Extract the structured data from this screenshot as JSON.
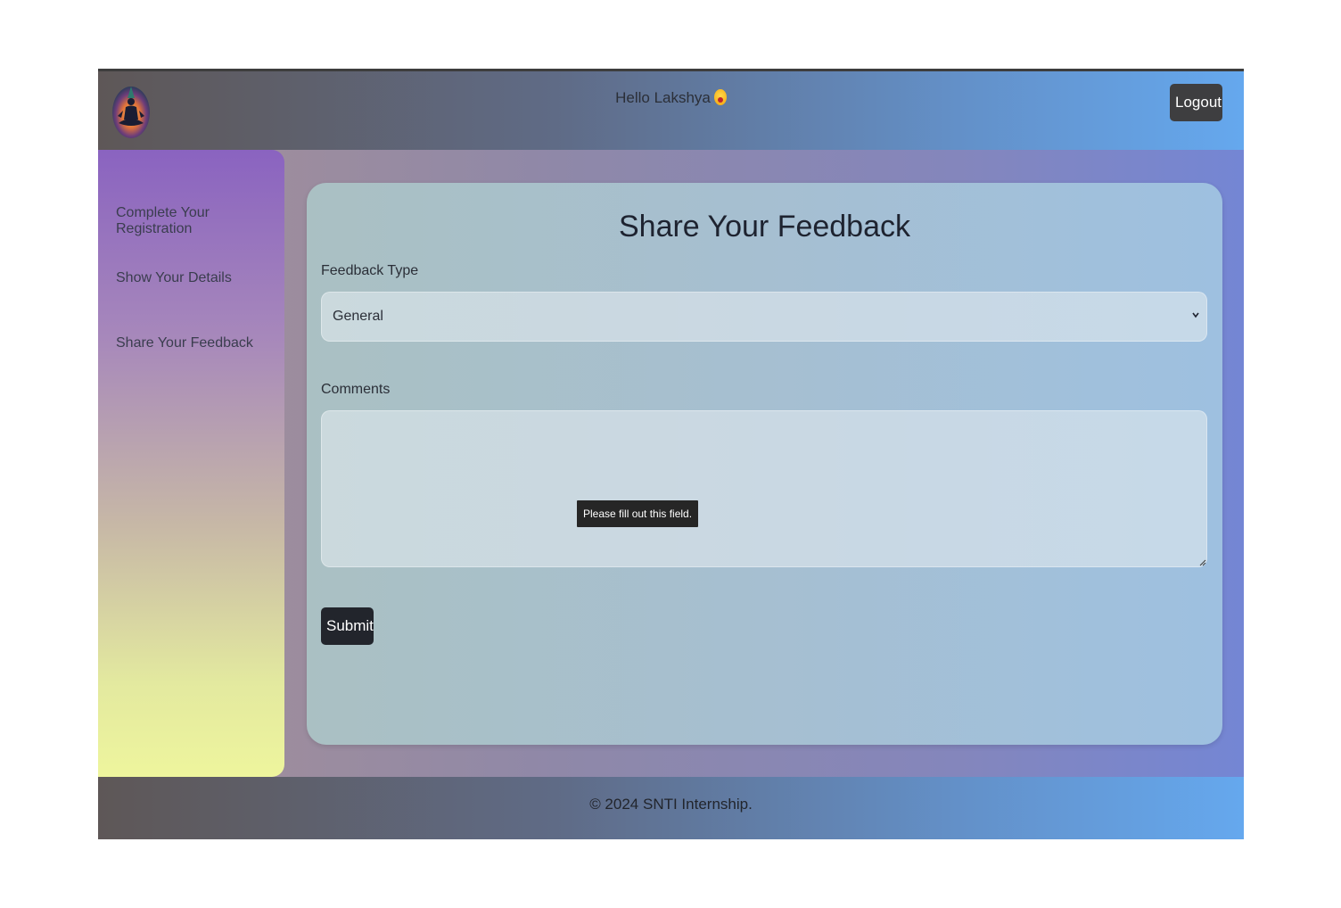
{
  "header": {
    "greeting": "Hello Lakshya",
    "logout_label": "Logout",
    "logo_icon": "meditation-logo-icon",
    "greeting_icon": "tongue-out-emoji-icon"
  },
  "sidebar": {
    "items": [
      {
        "label": "Complete Your Registration"
      },
      {
        "label": "Show Your Details"
      },
      {
        "label": "Share Your Feedback"
      }
    ]
  },
  "form": {
    "title": "Share Your Feedback",
    "feedback_type_label": "Feedback Type",
    "feedback_type_value": "General",
    "comments_label": "Comments",
    "comments_value": "",
    "validation_tooltip": "Please fill out this field.",
    "submit_label": "Submit"
  },
  "footer": {
    "text": "© 2024 SNTI Internship."
  },
  "colors": {
    "button_dark": "#22252c",
    "logout_button": "#3e3e40",
    "tooltip_bg": "#262626"
  }
}
